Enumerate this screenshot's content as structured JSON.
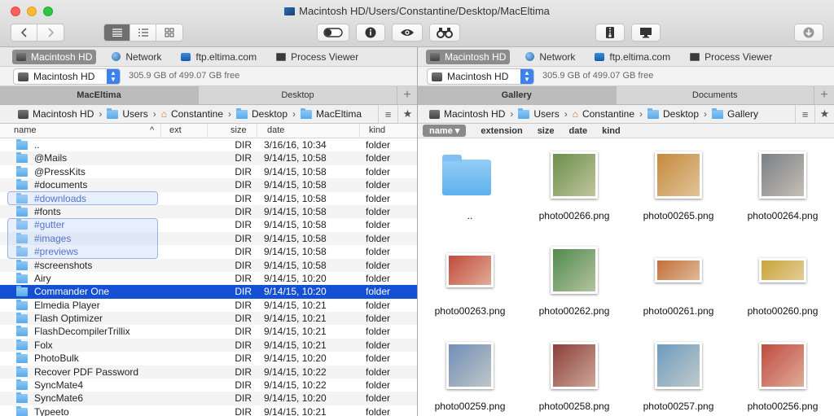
{
  "window": {
    "title": "Macintosh HD/Users/Constantine/Desktop/MacEltima"
  },
  "favorites": [
    "Macintosh HD",
    "Network",
    "ftp.eltima.com",
    "Process Viewer"
  ],
  "left": {
    "drive": "Macintosh HD",
    "free_space": "305.9 GB of 499.07 GB free",
    "tabs": [
      "MacEltima",
      "Desktop"
    ],
    "breadcrumb": [
      "Macintosh HD",
      "Users",
      "Constantine",
      "Desktop",
      "MacEltima"
    ],
    "columns": {
      "name": "name",
      "ext": "ext",
      "size": "size",
      "date": "date",
      "kind": "kind"
    },
    "rows": [
      {
        "name": "..",
        "size": "DIR",
        "date": "3/16/16, 10:34",
        "kind": "folder"
      },
      {
        "name": "@Mails",
        "size": "DIR",
        "date": "9/14/15, 10:58",
        "kind": "folder"
      },
      {
        "name": "@PressKits",
        "size": "DIR",
        "date": "9/14/15, 10:58",
        "kind": "folder"
      },
      {
        "name": "#documents",
        "size": "DIR",
        "date": "9/14/15, 10:58",
        "kind": "folder"
      },
      {
        "name": "#downloads",
        "size": "DIR",
        "date": "9/14/15, 10:58",
        "kind": "folder"
      },
      {
        "name": "#fonts",
        "size": "DIR",
        "date": "9/14/15, 10:58",
        "kind": "folder"
      },
      {
        "name": "#gutter",
        "size": "DIR",
        "date": "9/14/15, 10:58",
        "kind": "folder"
      },
      {
        "name": "#images",
        "size": "DIR",
        "date": "9/14/15, 10:58",
        "kind": "folder"
      },
      {
        "name": "#previews",
        "size": "DIR",
        "date": "9/14/15, 10:58",
        "kind": "folder"
      },
      {
        "name": "#screenshots",
        "size": "DIR",
        "date": "9/14/15, 10:58",
        "kind": "folder"
      },
      {
        "name": "Airy",
        "size": "DIR",
        "date": "9/14/15, 10:20",
        "kind": "folder"
      },
      {
        "name": "Commander One",
        "size": "DIR",
        "date": "9/14/15, 10:20",
        "kind": "folder"
      },
      {
        "name": "Elmedia Player",
        "size": "DIR",
        "date": "9/14/15, 10:21",
        "kind": "folder"
      },
      {
        "name": "Flash Optimizer",
        "size": "DIR",
        "date": "9/14/15, 10:21",
        "kind": "folder"
      },
      {
        "name": "FlashDecompilerTrillix",
        "size": "DIR",
        "date": "9/14/15, 10:21",
        "kind": "folder"
      },
      {
        "name": "Folx",
        "size": "DIR",
        "date": "9/14/15, 10:21",
        "kind": "folder"
      },
      {
        "name": "PhotoBulk",
        "size": "DIR",
        "date": "9/14/15, 10:20",
        "kind": "folder"
      },
      {
        "name": "Recover PDF Password",
        "size": "DIR",
        "date": "9/14/15, 10:22",
        "kind": "folder"
      },
      {
        "name": "SyncMate4",
        "size": "DIR",
        "date": "9/14/15, 10:22",
        "kind": "folder"
      },
      {
        "name": "SyncMate6",
        "size": "DIR",
        "date": "9/14/15, 10:20",
        "kind": "folder"
      },
      {
        "name": "Typeeto",
        "size": "DIR",
        "date": "9/14/15, 10:21",
        "kind": "folder"
      }
    ]
  },
  "right": {
    "drive": "Macintosh HD",
    "free_space": "305.9 GB of 499.07 GB free",
    "tabs": [
      "Gallery",
      "Documents"
    ],
    "breadcrumb": [
      "Macintosh HD",
      "Users",
      "Constantine",
      "Desktop",
      "Gallery"
    ],
    "sort": [
      "name",
      "extension",
      "size",
      "date",
      "kind"
    ],
    "items": [
      {
        "label": "..",
        "color": "#5fb0ec"
      },
      {
        "label": "photo00266.png",
        "color": "#6b8f4a"
      },
      {
        "label": "photo00265.png",
        "color": "#c48a3c"
      },
      {
        "label": "photo00264.png",
        "color": "#7a7f86"
      },
      {
        "label": "photo00263.png",
        "color": "#c24a3b"
      },
      {
        "label": "photo00262.png",
        "color": "#4f8a4d"
      },
      {
        "label": "photo00261.png",
        "color": "#c26f3a"
      },
      {
        "label": "photo00260.png",
        "color": "#c9a43a"
      },
      {
        "label": "photo00259.png",
        "color": "#6f8fb8"
      },
      {
        "label": "photo00258.png",
        "color": "#8d3f3a"
      },
      {
        "label": "photo00257.png",
        "color": "#6c9bbf"
      },
      {
        "label": "photo00256.png",
        "color": "#c04a3f"
      }
    ]
  }
}
